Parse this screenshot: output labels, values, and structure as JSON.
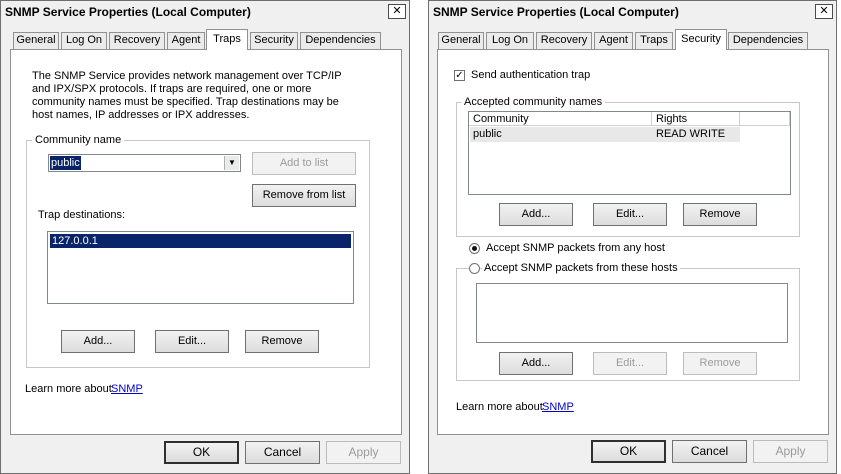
{
  "left_dialog": {
    "title": "SNMP Service Properties (Local Computer)",
    "close_glyph": "✕",
    "tabs": [
      "General",
      "Log On",
      "Recovery",
      "Agent",
      "Traps",
      "Security",
      "Dependencies"
    ],
    "active_tab": "Traps",
    "description": [
      "The SNMP Service provides network management over TCP/IP",
      "and IPX/SPX protocols. If traps are required, one or more",
      "community names must be specified. Trap destinations may be",
      "host names, IP addresses or IPX addresses."
    ],
    "community_group_label": "Community name",
    "community_value": "public",
    "add_to_list": "Add to list",
    "remove_from_list": "Remove from list",
    "trap_destinations_label": "Trap destinations:",
    "trap_destinations": [
      "127.0.0.1"
    ],
    "add_label": "Add...",
    "edit_label": "Edit...",
    "remove_label": "Remove",
    "learn_more_text": "Learn more about",
    "learn_more_link": "SNMP",
    "ok": "OK",
    "cancel": "Cancel",
    "apply": "Apply"
  },
  "right_dialog": {
    "title": "SNMP Service Properties (Local Computer)",
    "close_glyph": "✕",
    "tabs": [
      "General",
      "Log On",
      "Recovery",
      "Agent",
      "Traps",
      "Security",
      "Dependencies"
    ],
    "active_tab": "Security",
    "send_auth_trap_label": "Send authentication trap",
    "send_auth_trap_checked": true,
    "accepted_group_label": "Accepted community names",
    "table_headers": [
      "Community",
      "Rights"
    ],
    "table_rows": [
      {
        "community": "public",
        "rights": "READ WRITE"
      }
    ],
    "add_label": "Add...",
    "edit_label": "Edit...",
    "remove_label": "Remove",
    "accept_any_label": "Accept SNMP packets from any host",
    "accept_these_label": "Accept SNMP packets from these hosts",
    "accept_mode": "any",
    "hosts": [],
    "hosts_add_label": "Add...",
    "hosts_edit_label": "Edit...",
    "hosts_remove_label": "Remove",
    "learn_more_text": "Learn more about",
    "learn_more_link": "SNMP",
    "ok": "OK",
    "cancel": "Cancel",
    "apply": "Apply"
  },
  "colors": {
    "selection": "#0a246a",
    "link": "#0000cc",
    "disabled_text": "#9b9b9b"
  }
}
